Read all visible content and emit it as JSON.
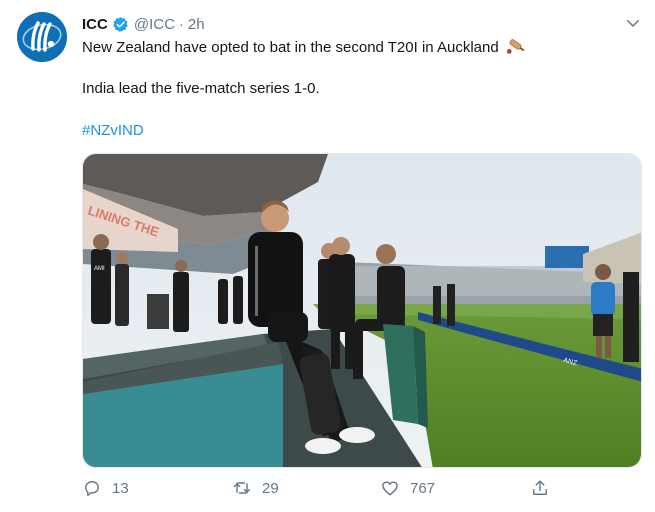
{
  "tweet": {
    "author_name": "ICC",
    "handle": "@ICC",
    "separator": "·",
    "time": "2h",
    "text_line1": "New Zealand have opted to bat in the second T20I in Auckland",
    "text_line2": "India lead the five-match series 1-0.",
    "hashtag": "#NZvIND",
    "photo_signage": {
      "stand_banner": "LINING THE",
      "player_sponsor": "AMI",
      "boundary_board": "ANZ"
    }
  },
  "actions": {
    "reply_count": "13",
    "retweet_count": "29",
    "like_count": "767"
  },
  "colors": {
    "brand": "#0e6fb5",
    "link": "#1b95e0",
    "muted": "#657786",
    "verified": "#1da1f2"
  }
}
